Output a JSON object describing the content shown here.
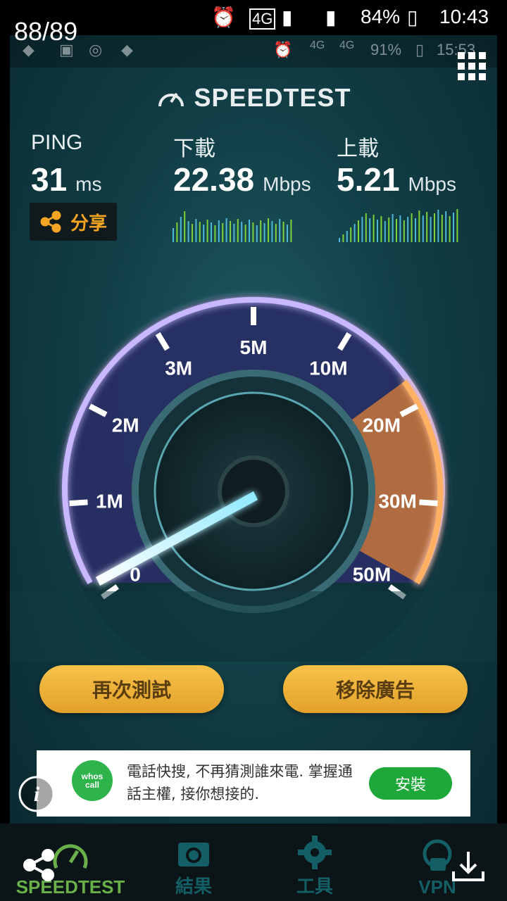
{
  "status_bar": {
    "network": "4G",
    "battery": "84%",
    "time": "10:43"
  },
  "inner_status": {
    "network_a": "4G",
    "network_b": "4G",
    "battery": "91%",
    "time": "15:53"
  },
  "viewer": {
    "counter": "88/89"
  },
  "app": {
    "brand": "SPEEDTEST",
    "ping": {
      "label": "PING",
      "value": "31",
      "unit": "ms"
    },
    "download": {
      "label": "下載",
      "value": "22.38",
      "unit": "Mbps"
    },
    "upload": {
      "label": "上載",
      "value": "5.21",
      "unit": "Mbps"
    },
    "share_label": "分享",
    "gauge": {
      "ticks": [
        "0",
        "1M",
        "2M",
        "3M",
        "5M",
        "10M",
        "20M",
        "30M",
        "50M"
      ]
    },
    "retest_button": "再次測試",
    "remove_ads_button": "移除廣告"
  },
  "ad": {
    "logo_line1": "whos",
    "logo_line2": "call",
    "text": "電話快搜, 不再猜測誰來電. 掌握通話主權, 接你想接的.",
    "install_button": "安裝"
  },
  "bottom_nav": {
    "items": [
      {
        "label": "SPEEDTEST"
      },
      {
        "label": "結果"
      },
      {
        "label": "工具"
      },
      {
        "label": "VPN"
      }
    ]
  },
  "colors": {
    "accent_gold": "#f3a523",
    "gauge_purple": "#a78be0",
    "gauge_orange": "#e8893a",
    "active_nav": "#6ab04a"
  }
}
